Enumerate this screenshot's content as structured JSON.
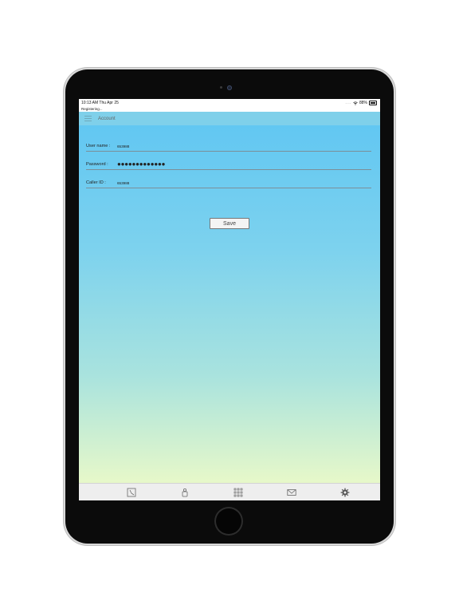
{
  "status_bar": {
    "time": "10:13 AM  Thu Apr 25",
    "signal": "....",
    "battery_percent": "88%"
  },
  "status": {
    "text": "Registering..."
  },
  "header": {
    "title": "Account"
  },
  "form": {
    "username_label": "User name :",
    "username_value": "653988",
    "password_label": "Password :",
    "password_value": "●●●●●●●●●●●●●",
    "caller_id_label": "Caller ID :",
    "caller_id_value": "653988"
  },
  "actions": {
    "save_label": "Save"
  },
  "tabs": [
    {
      "icon": "phone-icon"
    },
    {
      "icon": "contacts-icon"
    },
    {
      "icon": "keypad-icon"
    },
    {
      "icon": "mail-icon"
    },
    {
      "icon": "settings-icon"
    }
  ],
  "colors": {
    "nav_bar": "#7fd0ea",
    "gradient_top": "#62c7f2",
    "gradient_bottom": "#e7f8c9",
    "tab_bar": "#eeeeee"
  }
}
